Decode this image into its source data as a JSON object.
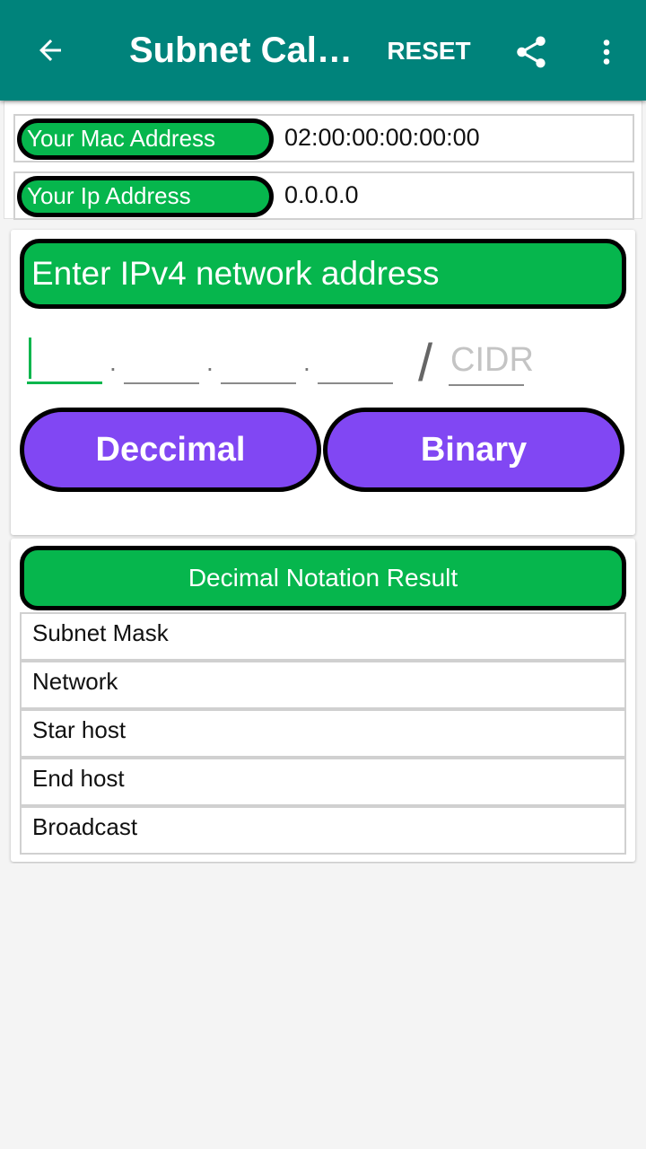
{
  "appbar": {
    "title": "Subnet Calc...",
    "reset_label": "RESET",
    "icons": [
      "arrow-back-icon",
      "share-icon",
      "more-vert-icon"
    ]
  },
  "device_info": {
    "mac_label": "Your Mac Address",
    "mac_value": "02:00:00:00:00:00",
    "ip_label": "Your Ip Address",
    "ip_value": "0.0.0.0"
  },
  "input": {
    "header": "Enter IPv4 network address",
    "octets": [
      "",
      "",
      "",
      ""
    ],
    "separator": ".",
    "slash": "/",
    "cidr_placeholder": "CIDR",
    "decimal_button": "Deccimal",
    "binary_button": "Binary"
  },
  "results": {
    "header": "Decimal Notation Result",
    "rows": [
      "Subnet Mask",
      "Network",
      "Star host",
      "End host",
      "Broadcast"
    ]
  },
  "colors": {
    "appbar": "#00837b",
    "green": "#06b64d",
    "purple": "#8147f3"
  }
}
